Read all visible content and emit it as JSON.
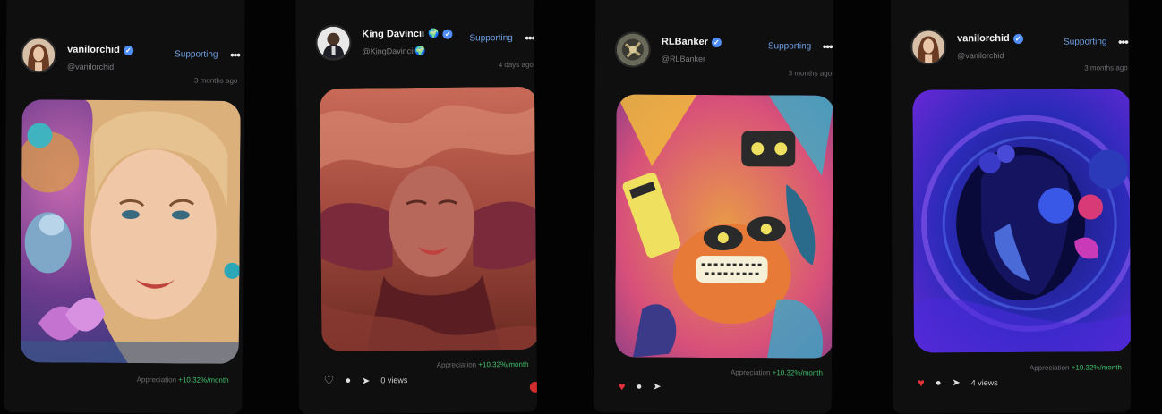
{
  "posts": [
    {
      "author": "vanilorchid",
      "handle": "@vanilorchid",
      "handle_emoji": "",
      "name_emoji": "",
      "action": "Supporting",
      "more": "•••",
      "time": "3 months ago",
      "appreciation_label": "Appreciation",
      "appreciation_value": "+10.32%/month",
      "views": "",
      "liked": false
    },
    {
      "author": "King Davincii",
      "handle": "@KingDavincii",
      "handle_emoji": "🌍",
      "name_emoji": "🌍",
      "action": "Supporting",
      "more": "•••",
      "time": "4 days ago",
      "appreciation_label": "Appreciation",
      "appreciation_value": "+10.32%/month",
      "views": "0 views",
      "liked": false
    },
    {
      "author": "RLBanker",
      "handle": "@RLBanker",
      "handle_emoji": "",
      "name_emoji": "",
      "action": "Supporting",
      "more": "•••",
      "time": "3 months ago",
      "appreciation_label": "Appreciation",
      "appreciation_value": "+10.32%/month",
      "views": "",
      "liked": true
    },
    {
      "author": "vanilorchid",
      "handle": "@vanilorchid",
      "handle_emoji": "",
      "name_emoji": "",
      "action": "Supporting",
      "more": "•••",
      "time": "3 months ago",
      "appreciation_label": "Appreciation",
      "appreciation_value": "+10.32%/month",
      "views": "4 views",
      "liked": true
    }
  ],
  "colors": {
    "background": "#030303",
    "card": "#0f0f10",
    "supporting": "#6fa0e4",
    "gain": "#3fbf6a",
    "verified": "#4f8df7",
    "liked": "#e2323a"
  },
  "icons": [
    "verified-badge-icon",
    "more-options-icon",
    "heart-icon",
    "comment-icon",
    "send-icon",
    "globe-icon"
  ]
}
